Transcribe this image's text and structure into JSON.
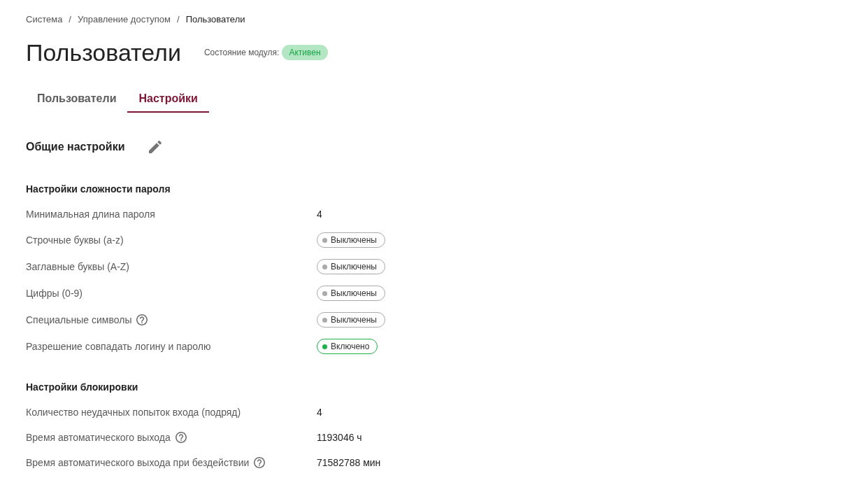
{
  "breadcrumb": [
    {
      "kind": "link",
      "label": "Система"
    },
    {
      "kind": "separator",
      "label": "/"
    },
    {
      "kind": "link",
      "label": "Управление доступом"
    },
    {
      "kind": "separator",
      "label": "/"
    },
    {
      "kind": "current",
      "label": "Пользователи"
    }
  ],
  "page_title": "Пользователи",
  "module_status": {
    "label": "Состояние модуля:",
    "value": "Активен",
    "active": true
  },
  "tabs": [
    {
      "label": "Пользователи",
      "selected": false
    },
    {
      "label": "Настройки",
      "selected": true
    }
  ],
  "section": {
    "title": "Общие настройки",
    "groups": [
      {
        "title": "Настройки сложности пароля",
        "rows": [
          {
            "kind": "text",
            "label": "Минимальная длина пароля",
            "help": false,
            "value": "4"
          },
          {
            "kind": "status",
            "label": "Строчные буквы (a-z)",
            "help": false,
            "value": "Выключены",
            "on": false
          },
          {
            "kind": "status",
            "label": "Заглавные буквы (A-Z)",
            "help": false,
            "value": "Выключены",
            "on": false
          },
          {
            "kind": "status",
            "label": "Цифры (0-9)",
            "help": false,
            "value": "Выключены",
            "on": false
          },
          {
            "kind": "status",
            "label": "Специальные символы",
            "help": true,
            "value": "Выключены",
            "on": false
          },
          {
            "kind": "status",
            "label": "Разрешение совпадать логину и паролю",
            "help": false,
            "value": "Включено",
            "on": true
          }
        ]
      },
      {
        "title": "Настройки блокировки",
        "rows": [
          {
            "kind": "text",
            "label": "Количество неудачных попыток входа (подряд)",
            "help": false,
            "value": "4"
          },
          {
            "kind": "text",
            "label": "Время автоматического выхода",
            "help": true,
            "value": "1193046 ч"
          },
          {
            "kind": "text",
            "label": "Время автоматического выхода при бездействии",
            "help": true,
            "value": "71582788 мин"
          }
        ]
      }
    ]
  }
}
